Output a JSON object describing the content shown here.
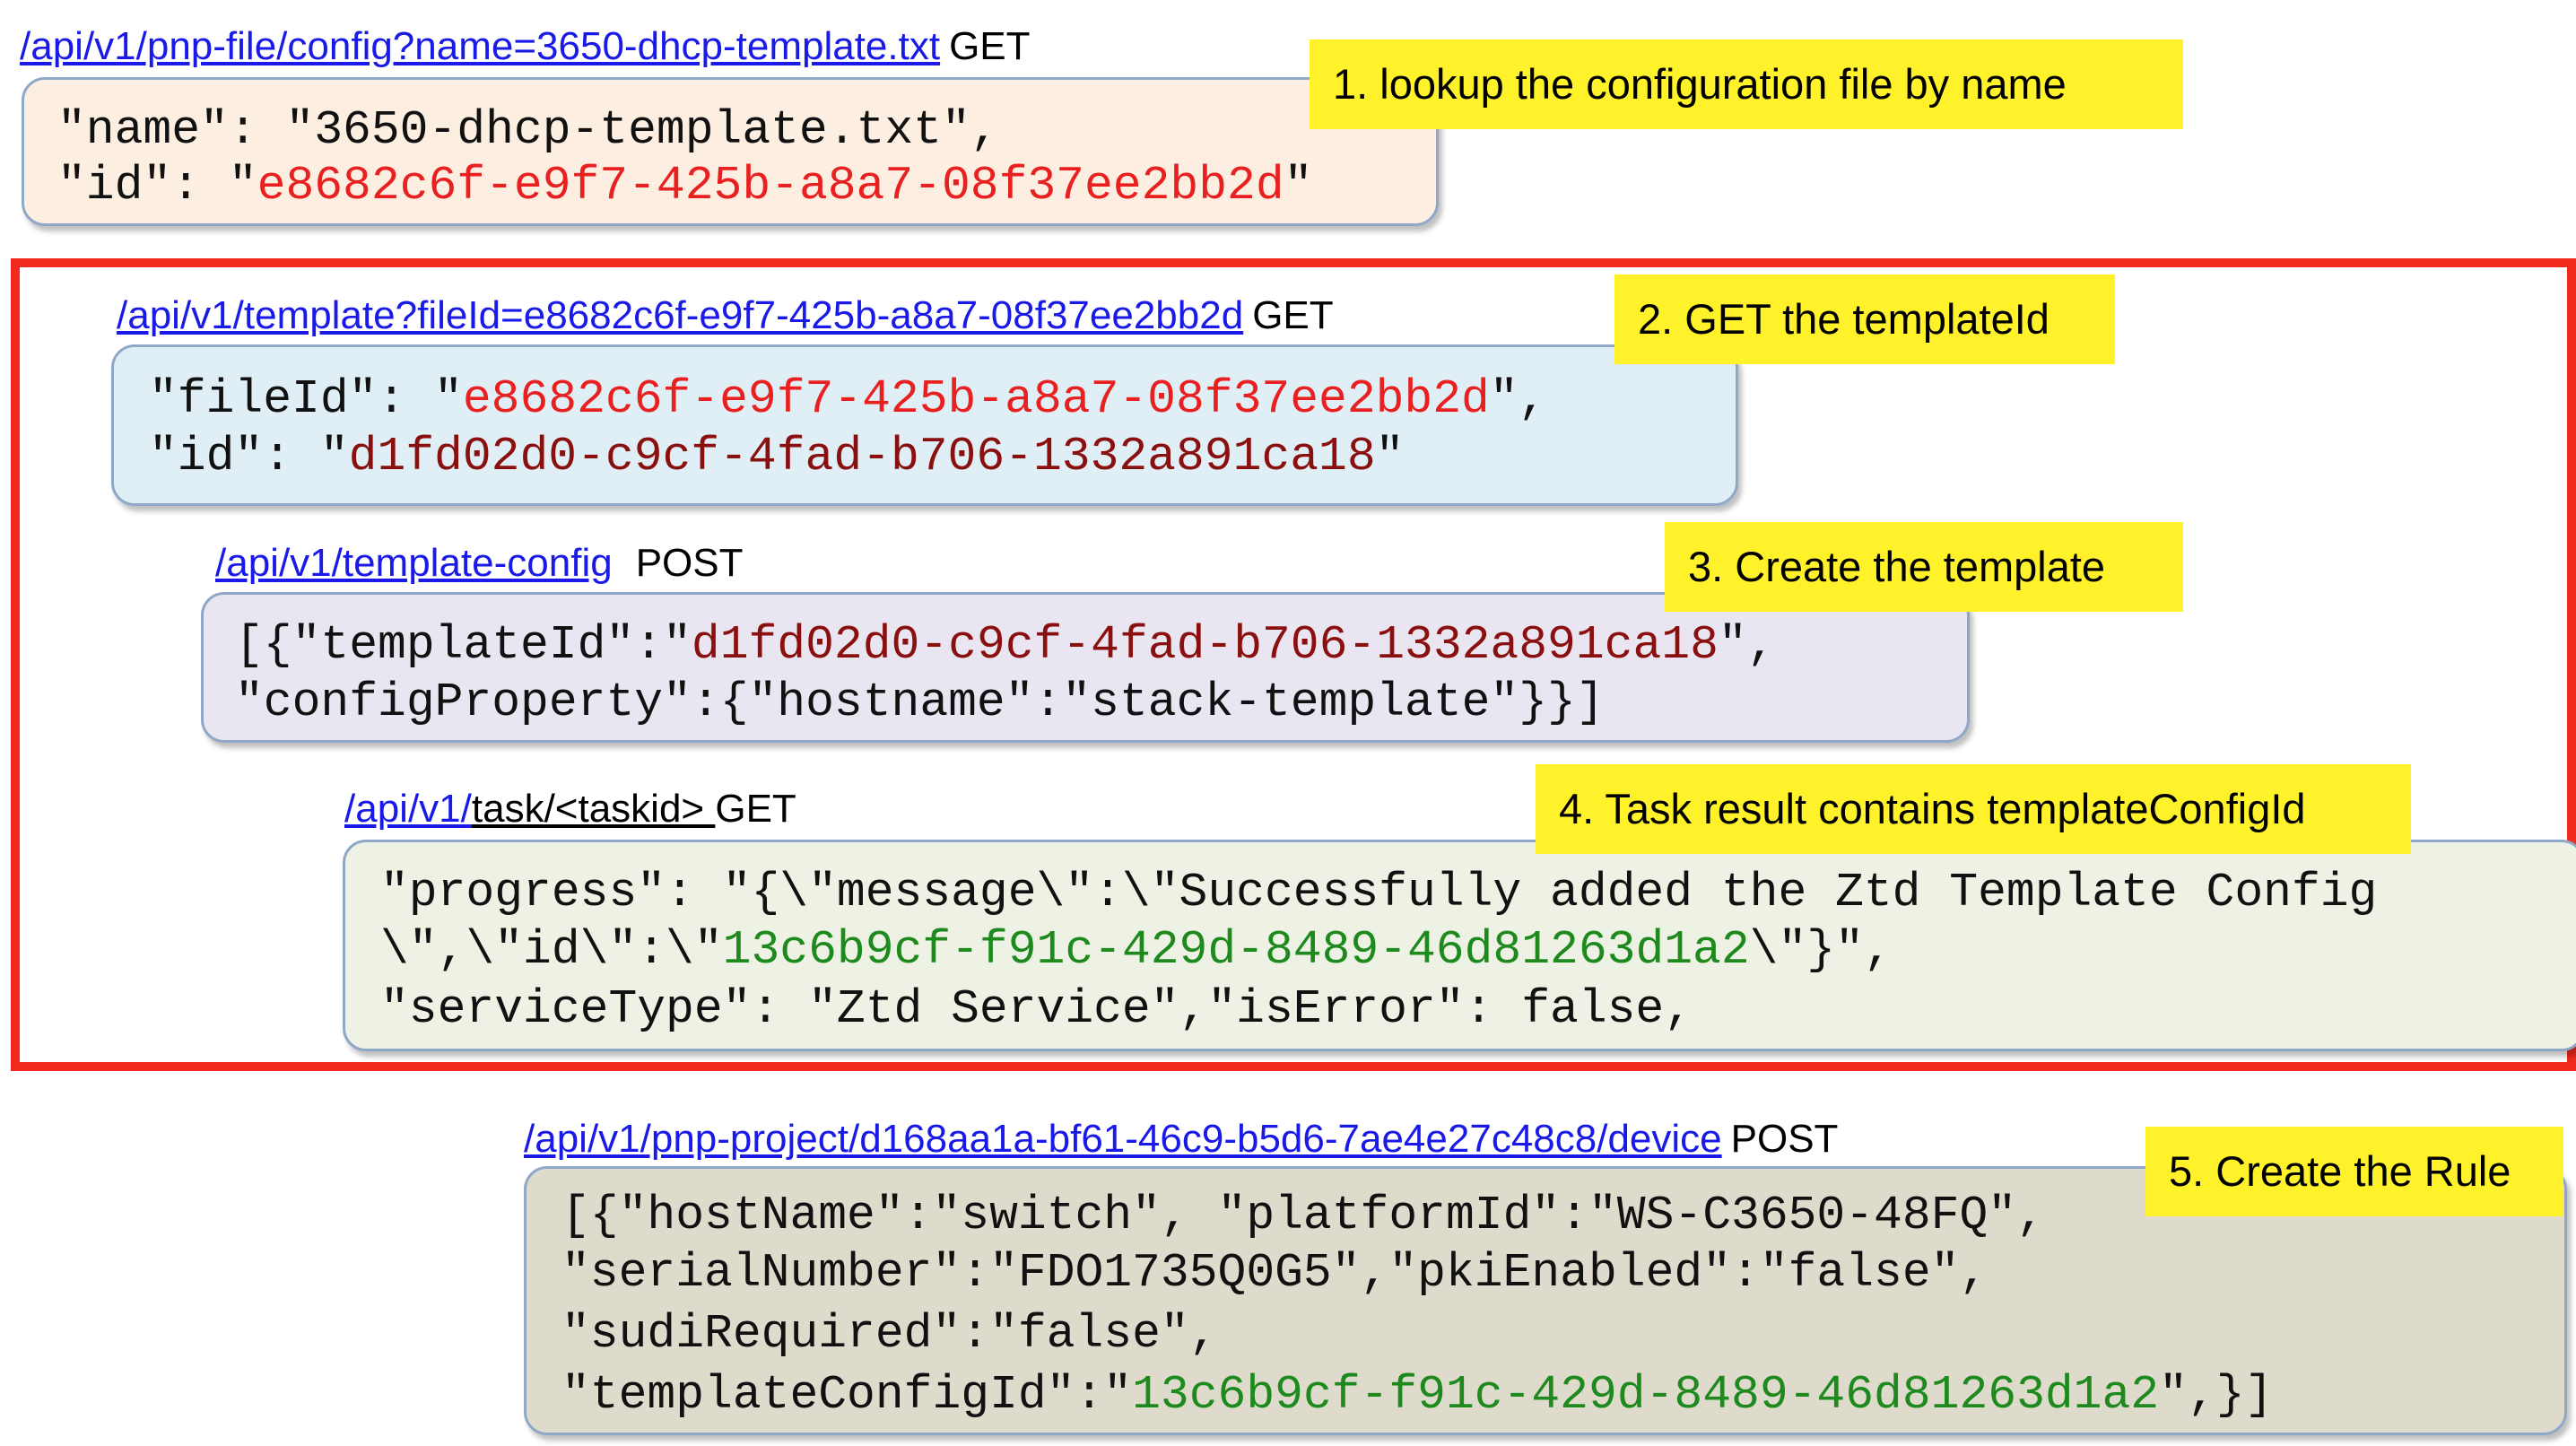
{
  "steps": [
    {
      "url": "/api/v1/pnp-file/config?name=3650-dhcp-template.txt",
      "method": "GET",
      "note": "1. lookup the configuration file by name",
      "code": {
        "l1": "\"name\": \"3650-dhcp-template.txt\",",
        "l2_pre": "\"id\": \"",
        "l2_id": "e8682c6f-e9f7-425b-a8a7-08f37ee2bb2d",
        "l2_post": "\""
      }
    },
    {
      "url": "/api/v1/template?fileId=e8682c6f-e9f7-425b-a8a7-08f37ee2bb2d",
      "method": "GET",
      "note": "2. GET the templateId",
      "code": {
        "l1_pre": "\"fileId\": \"",
        "l1_id": "e8682c6f-e9f7-425b-a8a7-08f37ee2bb2d",
        "l1_post": "\",",
        "l2_pre": "\"id\": \"",
        "l2_id": "d1fd02d0-c9cf-4fad-b706-1332a891ca18",
        "l2_post": "\""
      }
    },
    {
      "url": "/api/v1/template-config",
      "method": "POST",
      "note": "3. Create the template",
      "code": {
        "l1_pre": "[{\"templateId\":\"",
        "l1_id": "d1fd02d0-c9cf-4fad-b706-1332a891ca18",
        "l1_post": "\",",
        "l2": "\"configProperty\":{\"hostname\":\"stack-template\"}}]"
      }
    },
    {
      "url_prefix": "/api/v1/",
      "url_suffix": "task/<taskid> ",
      "method": "GET",
      "note": "4. Task result contains templateConfigId",
      "code": {
        "l1": "\"progress\": \"{\\\"message\\\":\\\"Successfully added the Ztd Template Config",
        "l2_pre": "\\\",\\\"id\\\":\\\"",
        "l2_id": "13c6b9cf-f91c-429d-8489-46d81263d1a2",
        "l2_post": "\\\"}\",",
        "l3": "\"serviceType\": \"Ztd Service\",\"isError\": false,"
      }
    },
    {
      "url": "/api/v1/pnp-project/d168aa1a-bf61-46c9-b5d6-7ae4e27c48c8/device",
      "method": "POST",
      "note": "5. Create the Rule",
      "code": {
        "l1": "[{\"hostName\":\"switch\", \"platformId\":\"WS-C3650-48FQ\",",
        "l2": "\"serialNumber\":\"FDO1735Q0G5\",\"pkiEnabled\":\"false\",",
        "l3": "\"sudiRequired\":\"false\",",
        "l4_pre": "\"templateConfigId\":\"",
        "l4_id": "13c6b9cf-f91c-429d-8489-46d81263d1a2",
        "l4_post": "\",}]"
      }
    }
  ],
  "colors": {
    "link": "#1a1ae8",
    "note_bg": "#fff22a",
    "frame": "#f02a1c",
    "id_red": "#e82020",
    "id_darkred": "#8a0f0f",
    "id_green": "#1e8a1e",
    "box1": "#fdeee2",
    "box2": "#e0eff6",
    "box3": "#e9e6f1",
    "box4": "#edf2e4",
    "box5": "#dedbcc"
  }
}
